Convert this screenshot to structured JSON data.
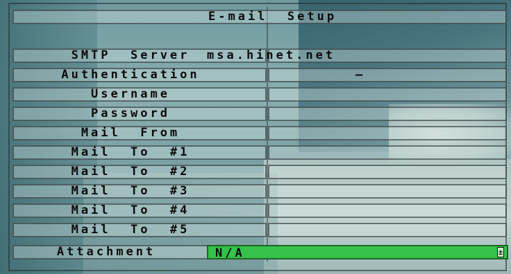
{
  "title": "E-mail  Setup",
  "rows": [
    {
      "label": "SMTP  Server",
      "value": "msa.hinet.net"
    },
    {
      "label": "Authentication",
      "value": "–"
    },
    {
      "label": "Username",
      "value": ""
    },
    {
      "label": "Password",
      "value": ""
    },
    {
      "label": "Mail  From",
      "value": ""
    },
    {
      "label": "Mail  To  #1",
      "value": ""
    },
    {
      "label": "Mail  To  #2",
      "value": ""
    },
    {
      "label": "Mail  To  #3",
      "value": ""
    },
    {
      "label": "Mail  To  #4",
      "value": ""
    },
    {
      "label": "Mail  To  #5",
      "value": ""
    }
  ],
  "attachment": {
    "label": "Attachment",
    "value": "N/A"
  }
}
